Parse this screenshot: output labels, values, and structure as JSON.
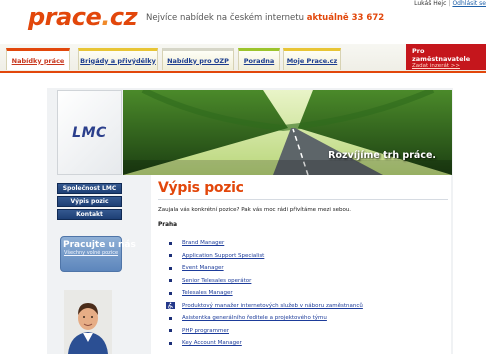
{
  "header": {
    "user_name": "Lukáš Hejc",
    "logout_label": "Odhlásit se",
    "logo_parts": [
      "prace",
      ".",
      "cz"
    ],
    "slogan": "Nejvíce nabídek na českém internetu",
    "slogan_highlight": "aktuálně 33 672"
  },
  "tabs": [
    {
      "label": "Nabídky práce",
      "active": true
    },
    {
      "label": "Brigády a přivýdělky",
      "active": false
    },
    {
      "label": "Nabídky pro OZP",
      "active": false
    },
    {
      "label": "Poradna",
      "active": false
    },
    {
      "label": "Moje Prace.cz",
      "active": false
    }
  ],
  "employers": {
    "heading": "Pro zaměstnavatele",
    "link": "Zadat inzerát >>"
  },
  "company": {
    "logo_text": "LMC",
    "banner_caption": "Rozvíjíme trh práce."
  },
  "sidebar": {
    "items": [
      {
        "label": "Společnost LMC"
      },
      {
        "label": "Výpis pozic"
      },
      {
        "label": "Kontakt"
      }
    ],
    "promo_title": "Pracujte u nás",
    "promo_link": "Všechny volné pozice"
  },
  "main": {
    "title": "Výpis pozic",
    "intro": "Zaujala vás konkrétní pozice? Pak vás moc rádi přivítáme mezi sebou.",
    "city": "Praha",
    "jobs": [
      {
        "label": "Brand Manager",
        "icon": "bullet"
      },
      {
        "label": "Application Support Specialist",
        "icon": "bullet"
      },
      {
        "label": "Event Manager",
        "icon": "bullet"
      },
      {
        "label": "Senior Telesales operátor",
        "icon": "bullet"
      },
      {
        "label": "Telesales Manager",
        "icon": "bullet"
      },
      {
        "label": "Produktový manažer internetových služeb v náboru zaměstnanců",
        "icon": "wheelchair-icon"
      },
      {
        "label": "Asistentka generálního ředitele a projektového týmu",
        "icon": "bullet"
      },
      {
        "label": "PHP programmer",
        "icon": "bullet"
      },
      {
        "label": "Key Account Manager",
        "icon": "bullet"
      }
    ]
  },
  "colors": {
    "brand_orange": "#e2470b",
    "employer_red": "#c5161c",
    "nav_blue": "#1d3f74",
    "link_blue": "#1d3c9a"
  }
}
